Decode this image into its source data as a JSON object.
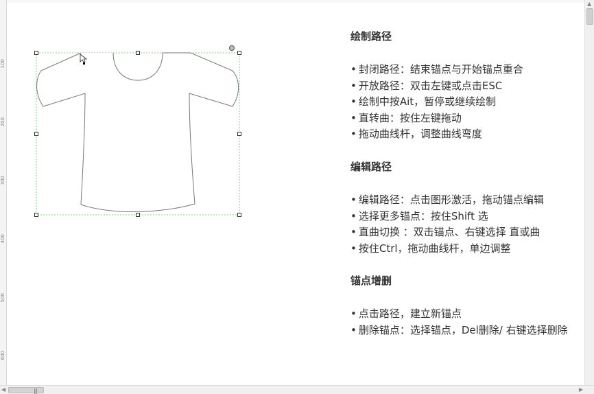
{
  "ruler": {
    "left_labels": [
      "100",
      "200",
      "300",
      "400",
      "500",
      "600"
    ]
  },
  "sections": [
    {
      "title": "绘制路径",
      "items": [
        "封闭路径：结束锚点与开始锚点重合",
        "开放路径：双击左键或点击ESC",
        "绘制中按Ait，暂停或继续绘制",
        "直转曲：按住左键拖动",
        "拖动曲线杆，调整曲线弯度"
      ]
    },
    {
      "title": "编辑路径",
      "items": [
        "编辑路径：点击图形激活，拖动锚点编辑",
        "选择更多锚点：按住Shift 选",
        "直曲切换 ：双击锚点、右键选择 直或曲",
        "按住Ctrl，拖动曲线杆，单边调整"
      ]
    },
    {
      "title": "锚点增删",
      "items": [
        "点击路径，建立新锚点",
        "删除锚点：选择锚点，Del删除/ 右键选择删除"
      ]
    }
  ],
  "bullet": "•",
  "colors": {
    "selection": "#7ed47e",
    "handle": "#333333",
    "shape_stroke": "#777777",
    "text": "#333333"
  },
  "icons": {
    "shirt": "tshirt-shape",
    "rotate": "rotate-handle-icon",
    "cursor": "arrow-cursor-icon"
  },
  "scrollbar": {
    "grip": "|||"
  }
}
